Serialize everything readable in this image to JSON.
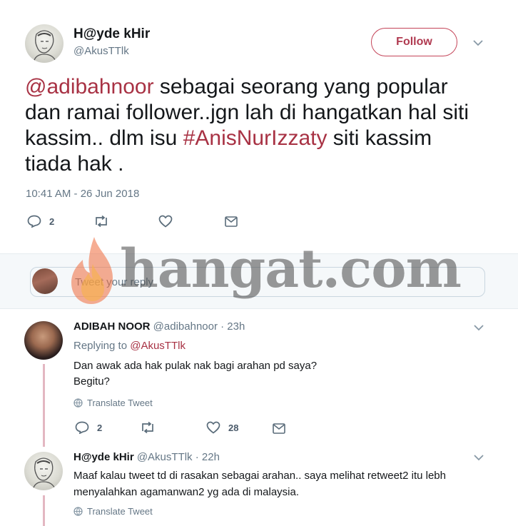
{
  "main_tweet": {
    "display_name": "H@yde kHir",
    "handle": "@AkusTTlk",
    "follow_label": "Follow",
    "text_mention": "@adibahnoor",
    "text_part1": " sebagai seorang yang popular dan ramai follower..jgn lah di hangatkan hal siti kassim.. dlm isu ",
    "text_hashtag": "#AnisNurIzzaty",
    "text_part2": " siti kassim tiada hak .",
    "timestamp": "10:41 AM - 26 Jun 2018",
    "reply_count": "2",
    "retweet_count": "",
    "like_count": ""
  },
  "reply_box": {
    "placeholder": "Tweet your reply"
  },
  "watermark": {
    "text": "hangat.com"
  },
  "replies": [
    {
      "display_name": "ADIBAH NOOR",
      "handle": "@adibahnoor",
      "time": "· 23h",
      "replying_prefix": "Replying to",
      "replying_to": "@AkusTTlk",
      "line1": "Dan awak ada hak pulak nak bagi arahan pd saya?",
      "line2": "Begitu?",
      "translate_label": "Translate Tweet",
      "reply_count": "2",
      "retweet_count": "",
      "like_count": "28"
    },
    {
      "display_name": "H@yde kHir",
      "handle": "@AkusTTlk",
      "time": "· 22h",
      "line1": "Maaf kalau tweet td di rasakan sebagai arahan.. saya melihat retweet2 itu lebh",
      "line2": "menyalahkan agamanwan2 yg ada di malaysia.",
      "translate_label": "Translate Tweet"
    }
  ],
  "colors": {
    "accent": "#b03a50",
    "link": "#a83244",
    "muted": "#657786",
    "thread_line": "#e3b7c2"
  }
}
